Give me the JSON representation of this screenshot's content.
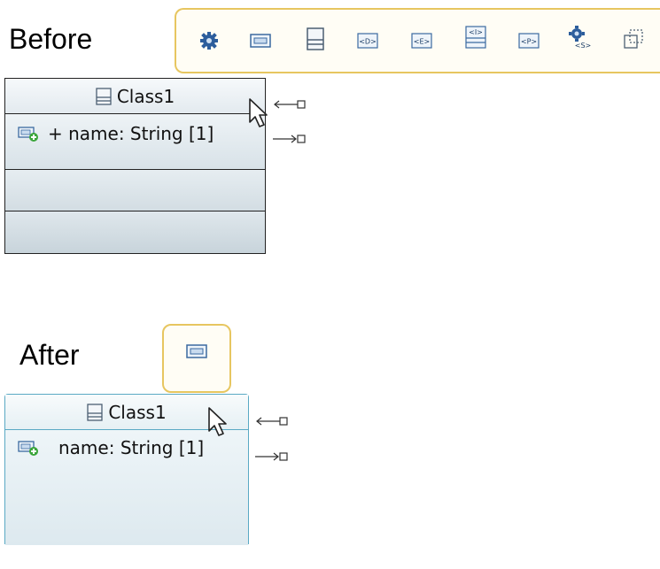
{
  "labels": {
    "before": "Before",
    "after": "After"
  },
  "palette_before": {
    "tools": [
      {
        "name": "class-palette-icon"
      },
      {
        "name": "attribute-palette-icon"
      },
      {
        "name": "nested-class-palette-icon"
      },
      {
        "name": "datatype-palette-icon",
        "tag": "<D>"
      },
      {
        "name": "enumeration-palette-icon",
        "tag": "<E>"
      },
      {
        "name": "interface-palette-icon",
        "tag": "<I>"
      },
      {
        "name": "primitive-palette-icon",
        "tag": "<P>"
      },
      {
        "name": "stereotype-palette-icon",
        "tag": "<S>"
      },
      {
        "name": "more-palette-icon"
      }
    ]
  },
  "palette_after": {
    "tools": [
      {
        "name": "attribute-palette-icon"
      }
    ]
  },
  "class_before": {
    "name": "Class1",
    "attribute": "+ name: String [1]"
  },
  "class_after": {
    "name": "Class1",
    "attribute": "name: String [1]"
  },
  "colors": {
    "palette_border": "#e7c660",
    "selected_border": "#5aa9c4",
    "plus_green": "#3aa53a"
  }
}
